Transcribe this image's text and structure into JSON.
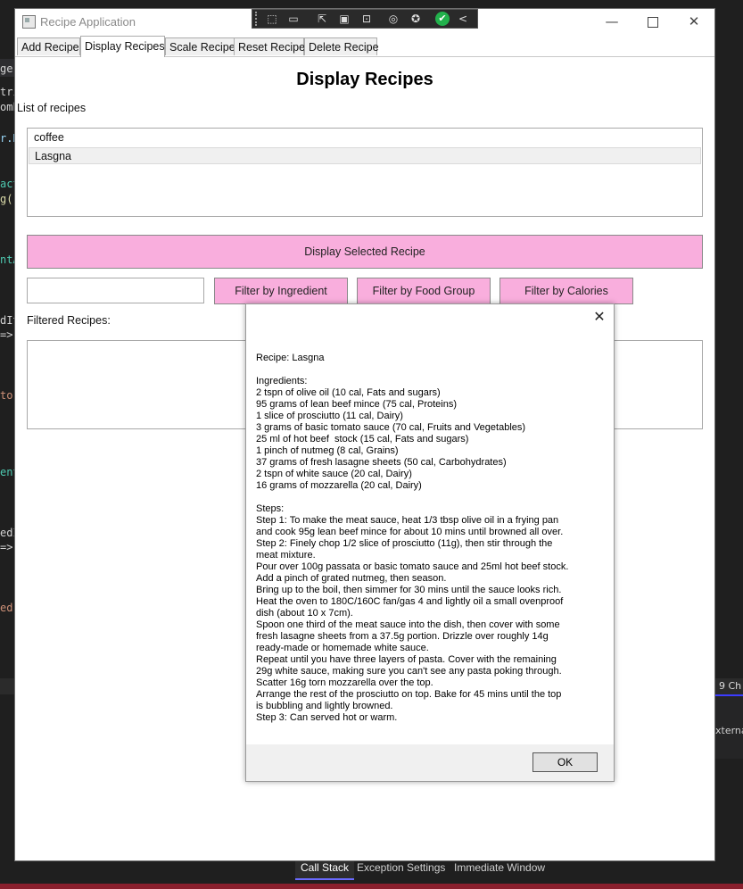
{
  "ide": {
    "code_fragments": [
      {
        "text": "ger",
        "color": "#d4d4d4"
      },
      {
        "text": "tri",
        "color": "#d4d4d4"
      },
      {
        "text": "omb",
        "color": "#d4d4d4"
      },
      {
        "text": "r.R",
        "color": "#9cdcfe"
      },
      {
        "text": "act",
        "color": "#4ec9b0"
      },
      {
        "text": "g()",
        "color": "#dcdcaa"
      },
      {
        "text": "ntA",
        "color": "#4ec9b0"
      },
      {
        "text": "dIt",
        "color": "#d4d4d4"
      },
      {
        "text": " =>",
        "color": "#d4d4d4"
      },
      {
        "text": " to",
        "color": "#ce9178"
      },
      {
        "text": "ent",
        "color": "#4ec9b0"
      },
      {
        "text": "edI",
        "color": "#d4d4d4"
      },
      {
        "text": " =>",
        "color": "#d4d4d4"
      },
      {
        "text": "ed.",
        "color": "#ce9178"
      }
    ],
    "right_strip_text": "9  Ch",
    "right_panel_text": "xternal",
    "bottom_tabs": [
      "Call Stack",
      "Exception Settings",
      "Immediate Window"
    ],
    "active_bottom_tab": "Call Stack"
  },
  "window": {
    "title": "Recipe Application",
    "min_glyph": "—",
    "close_glyph": "✕"
  },
  "debug_toolbar": {
    "icons": [
      "select-element-icon",
      "display-layout-icon",
      "track-focus-icon",
      "hot-reload-icon",
      "accessibility-icon",
      "check-icon",
      "collapse-icon"
    ],
    "collapse_glyph": "<"
  },
  "tabs": [
    "Add Recipe",
    "Display Recipes",
    "Scale Recipe",
    "Reset Recipe",
    "Delete Recipe"
  ],
  "selected_tab": "Display Recipes",
  "page": {
    "title": "Display Recipes",
    "list_label": "List of recipes",
    "recipes": [
      "coffee",
      "Lasgna"
    ],
    "selected_recipe": "Lasgna",
    "display_button": "Display Selected Recipe",
    "filter_input_value": "",
    "filter_buttons": [
      "Filter by Ingredient",
      "Filter by Food Group",
      "Filter by Calories"
    ],
    "filtered_label": "Filtered Recipes:"
  },
  "colors": {
    "button_pink": "#f9aedd",
    "ide_background": "#1f1f1f",
    "debug_check": "#22b14c"
  },
  "message_box": {
    "close_glyph": "✕",
    "text": "Recipe: Lasgna\n\nIngredients:\n2 tspn of olive oil (10 cal, Fats and sugars)\n95 grams of lean beef mince (75 cal, Proteins)\n1 slice of prosciutto (11 cal, Dairy)\n3 grams of basic tomato sauce (70 cal, Fruits and Vegetables)\n25 ml of hot beef  stock (15 cal, Fats and sugars)\n1 pinch of nutmeg (8 cal, Grains)\n37 grams of fresh lasagne sheets (50 cal, Carbohydrates)\n2 tspn of white sauce (20 cal, Dairy)\n16 grams of mozzarella (20 cal, Dairy)\n\nSteps:\nStep 1: To make the meat sauce, heat 1/3 tbsp olive oil in a frying pan\nand cook 95g lean beef mince for about 10 mins until browned all over.\nStep 2: Finely chop 1/2 slice of prosciutto (11g), then stir through the\nmeat mixture.\nPour over 100g passata or basic tomato sauce and 25ml hot beef stock.\nAdd a pinch of grated nutmeg, then season.\nBring up to the boil, then simmer for 30 mins until the sauce looks rich.\nHeat the oven to 180C/160C fan/gas 4 and lightly oil a small ovenproof\ndish (about 10 x 7cm).\nSpoon one third of the meat sauce into the dish, then cover with some\nfresh lasagne sheets from a 37.5g portion. Drizzle over roughly 14g\nready-made or homemade white sauce.\nRepeat until you have three layers of pasta. Cover with the remaining\n29g white sauce, making sure you can't see any pasta poking through.\nScatter 16g torn mozzarella over the top.\nArrange the rest of the prosciutto on top. Bake for 45 mins until the top\nis bubbling and lightly browned.\nStep 3: Can served hot or warm.",
    "ok_label": "OK"
  }
}
